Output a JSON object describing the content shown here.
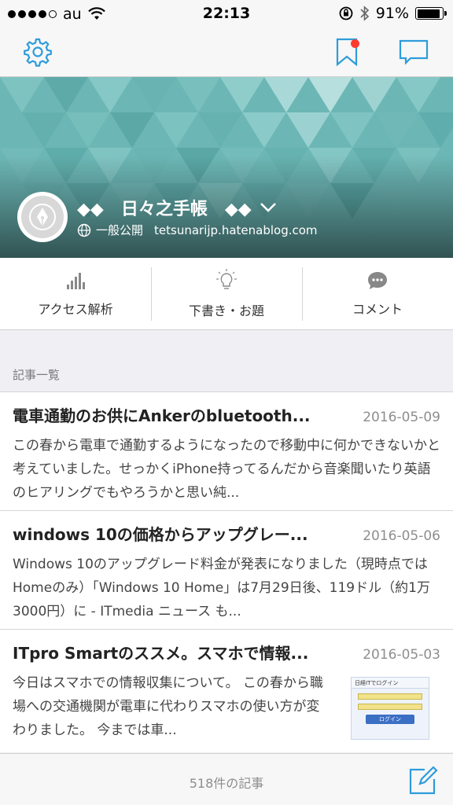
{
  "status_bar": {
    "carrier": "au",
    "time": "22:13",
    "battery": "91%",
    "battery_level": 0.91
  },
  "nav": {
    "settings_icon": "gear-icon",
    "bookmark_icon": "bookmark-icon",
    "comment_icon": "comment-icon"
  },
  "blog": {
    "title": "◆◆　日々之手帳　◆◆",
    "visibility": "一般公開",
    "url": "tetsunarijp.hatenablog.com",
    "colors": {
      "accent": "#2d9cdb",
      "banner": "#6cb7b6"
    }
  },
  "actions": [
    {
      "label": "アクセス解析",
      "icon": "bar-chart-icon"
    },
    {
      "label": "下書き・お題",
      "icon": "lightbulb-icon"
    },
    {
      "label": "コメント",
      "icon": "speech-bubble-icon"
    }
  ],
  "section_title": "記事一覧",
  "entries": [
    {
      "title": "電車通勤のお供にAnkerのbluetooth...",
      "date": "2016-05-09",
      "excerpt": "この春から電車で通勤するようになったので移動中に何かできないかと考えていました。せっかくiPhone持ってるんだから音楽聞いたり英語のヒアリングでもやろうかと思い純..."
    },
    {
      "title": "windows 10の価格からアップグレー...",
      "date": "2016-05-06",
      "excerpt": "Windows 10のアップグレード料金が発表になりました（現時点ではHomeのみ）「Windows 10 Home」は7月29日後、119ドル（約1万3000円）に - ITmedia ニュース も..."
    },
    {
      "title": "ITpro Smartのススメ。スマホで情報...",
      "date": "2016-05-03",
      "excerpt": "今日はスマホでの情報収集について。 この春から職場への交通機関が電車に代わりスマホの使い方が変わりました。 今までは車...",
      "thumb": {
        "heading": "日経ITでログイン",
        "button": "ログイン"
      }
    }
  ],
  "footer": {
    "count": "518件の記事",
    "compose_icon": "compose-icon"
  }
}
